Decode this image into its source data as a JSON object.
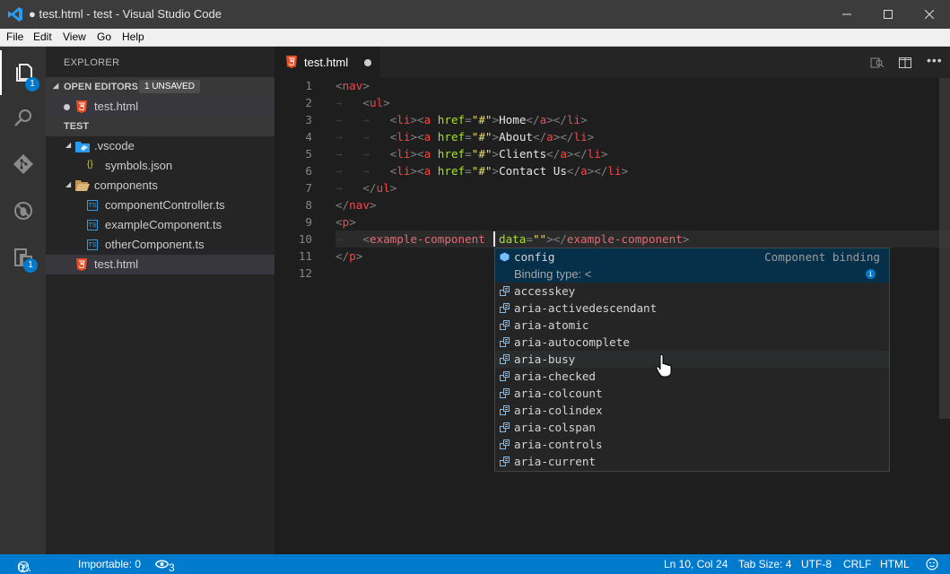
{
  "window": {
    "title": "● test.html - test - Visual Studio Code"
  },
  "menu": [
    "File",
    "Edit",
    "View",
    "Go",
    "Help"
  ],
  "activity": {
    "explorer_badge": "1",
    "extensions_badge": "1"
  },
  "sidebar": {
    "title": "EXPLORER",
    "open_editors": {
      "label": "OPEN EDITORS",
      "badge": "1 UNSAVED",
      "items": [
        "test.html"
      ]
    },
    "folder": {
      "label": "TEST"
    },
    "tree": [
      {
        "name": ".vscode"
      },
      {
        "name": "symbols.json"
      },
      {
        "name": "components"
      },
      {
        "name": "componentController.ts"
      },
      {
        "name": "exampleComponent.ts"
      },
      {
        "name": "otherComponent.ts"
      },
      {
        "name": "test.html"
      }
    ]
  },
  "editor": {
    "tab": "test.html",
    "line_numbers": [
      "1",
      "2",
      "3",
      "4",
      "5",
      "6",
      "7",
      "8",
      "9",
      "10",
      "11",
      "12"
    ],
    "links": [
      "Home",
      "About",
      "Clients",
      "Contact Us"
    ],
    "href": "\"#\""
  },
  "suggest": {
    "focused": {
      "label": "config",
      "detail": "Component binding",
      "doc": "Binding type: <"
    },
    "items": [
      "accesskey",
      "aria-activedescendant",
      "aria-atomic",
      "aria-autocomplete",
      "aria-busy",
      "aria-checked",
      "aria-colcount",
      "aria-colindex",
      "aria-colspan",
      "aria-controls",
      "aria-current"
    ],
    "hover_index": 4
  },
  "status": {
    "errors": "0",
    "warnings": "0",
    "importable": "Importable: 0",
    "watchers": "3",
    "position": "Ln 10, Col 24",
    "tab_size": "Tab Size: 4",
    "encoding": "UTF-8",
    "eol": "CRLF",
    "language": "HTML"
  },
  "colors": {
    "accent": "#007acc",
    "tag": "#f44747",
    "attr": "#a6e22e",
    "string": "#e6db74"
  }
}
